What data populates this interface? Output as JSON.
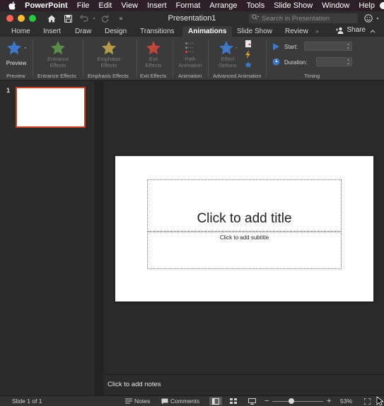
{
  "menubar": {
    "items": [
      "PowerPoint",
      "File",
      "Edit",
      "View",
      "Insert",
      "Format",
      "Arrange",
      "Tools",
      "Slide Show",
      "Window",
      "Help"
    ]
  },
  "titlebar": {
    "title": "Presentation1",
    "search_placeholder": "Search in Presentation"
  },
  "tabs": [
    "Home",
    "Insert",
    "Draw",
    "Design",
    "Transitions",
    "Animations",
    "Slide Show",
    "Review"
  ],
  "active_tab": "Animations",
  "share_label": "Share",
  "ribbon": {
    "preview": {
      "label": "Preview",
      "group": "Preview"
    },
    "entrance": {
      "label1": "Entrance",
      "label2": "Effects",
      "group": "Entrance Effects"
    },
    "emphasis": {
      "label1": "Emphasis",
      "label2": "Effects",
      "group": "Emphasis Effects"
    },
    "exit": {
      "label1": "Exit",
      "label2": "Effects",
      "group": "Exit Effects"
    },
    "path": {
      "label1": "Path",
      "label2": "Animation",
      "group": "Animation"
    },
    "effect_options": {
      "label1": "Effect",
      "label2": "Options",
      "group": "Advanced Animation"
    },
    "timing": {
      "start_label": "Start:",
      "duration_label": "Duration:",
      "group": "Timing"
    }
  },
  "thumbnails": {
    "slide_number": "1"
  },
  "slide": {
    "title_placeholder": "Click to add title",
    "subtitle_placeholder": "Click to add subtitle"
  },
  "notes_placeholder": "Click to add notes",
  "statusbar": {
    "slide_info": "Slide 1 of 1",
    "notes_label": "Notes",
    "comments_label": "Comments",
    "zoom": "53%",
    "zoom_fraction": 0.37
  },
  "colors": {
    "accent_tab_border": "#c0432b",
    "star_blue": "#3d79c7",
    "star_green": "#5b8c4a",
    "star_gold": "#b59a4a",
    "star_red": "#c0453c"
  }
}
